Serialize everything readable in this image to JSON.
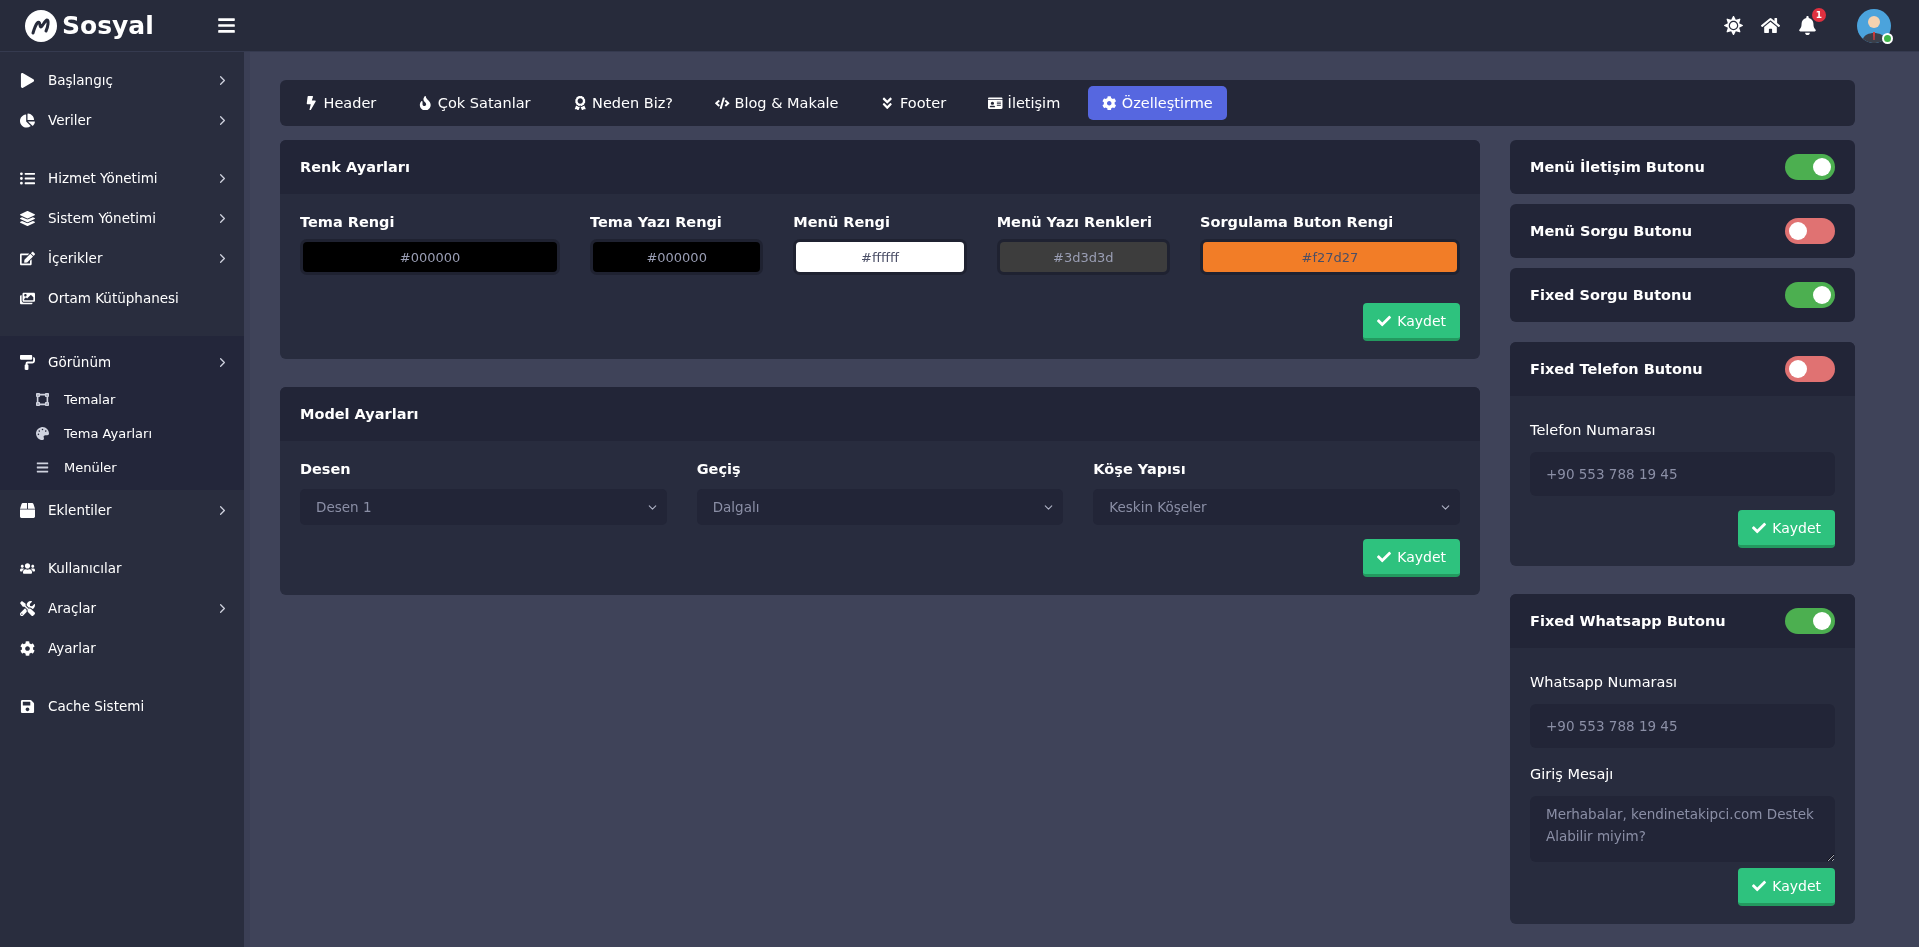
{
  "brand": {
    "name": "Sosyal"
  },
  "topbar": {
    "notifications": "1",
    "user_online": true
  },
  "sidebar": {
    "sections": [
      [
        {
          "label": "Başlangıç",
          "arrow": true,
          "expanded": false
        },
        {
          "label": "Veriler",
          "arrow": true,
          "expanded": false
        }
      ],
      [
        {
          "label": "Hizmet Yönetimi",
          "arrow": true,
          "expanded": false
        },
        {
          "label": "Sistem Yönetimi",
          "arrow": true,
          "expanded": false
        },
        {
          "label": "İçerikler",
          "arrow": true,
          "expanded": false
        },
        {
          "label": "Ortam Kütüphanesi",
          "arrow": false,
          "expanded": false
        }
      ],
      [
        {
          "label": "Görünüm",
          "arrow": true,
          "expanded": true,
          "children": [
            {
              "label": "Temalar"
            },
            {
              "label": "Tema Ayarları"
            },
            {
              "label": "Menüler"
            }
          ]
        },
        {
          "label": "Eklentiler",
          "arrow": true,
          "expanded": false
        }
      ],
      [
        {
          "label": "Kullanıcılar",
          "arrow": false,
          "expanded": false
        },
        {
          "label": "Araçlar",
          "arrow": true,
          "expanded": false
        },
        {
          "label": "Ayarlar",
          "arrow": false,
          "expanded": false
        }
      ],
      [
        {
          "label": "Cache Sistemi",
          "arrow": false,
          "expanded": false
        }
      ]
    ]
  },
  "tabs": [
    {
      "label": "Header",
      "selected": false
    },
    {
      "label": "Çok Satanlar",
      "selected": false
    },
    {
      "label": "Neden Biz?",
      "selected": false
    },
    {
      "label": "Blog & Makale",
      "selected": false
    },
    {
      "label": "Footer",
      "selected": false
    },
    {
      "label": "İletişim",
      "selected": false
    },
    {
      "label": "Özelleştirme",
      "selected": true
    }
  ],
  "renk": {
    "title": "Renk Ayarları",
    "button": "Kaydet",
    "fields": [
      {
        "label": "Tema Rengi",
        "value": "#000000",
        "color": "#000000"
      },
      {
        "label": "Tema Yazı Rengi",
        "value": "#000000",
        "color": "#000000"
      },
      {
        "label": "Menü Rengi",
        "value": "#ffffff",
        "color": "#ffffff"
      },
      {
        "label": "Menü Yazı Renkleri",
        "value": "#3d3d3d",
        "color": "#3d3d3d"
      },
      {
        "label": "Sorgulama Buton Rengi",
        "value": "#f27d27",
        "color": "#f27d27"
      }
    ]
  },
  "model": {
    "title": "Model Ayarları",
    "button": "Kaydet",
    "selects": [
      {
        "label": "Desen",
        "value": "Desen 1"
      },
      {
        "label": "Geçiş",
        "value": "Dalgalı"
      },
      {
        "label": "Köşe Yapısı",
        "value": "Keskin Köşeler"
      }
    ]
  },
  "toggles": [
    {
      "title": "Menü İletişim Butonu",
      "on": true
    },
    {
      "title": "Menü Sorgu Butonu",
      "on": false
    },
    {
      "title": "Fixed Sorgu Butonu",
      "on": true
    },
    {
      "title": "Fixed Telefon Butonu",
      "on": false,
      "button": "Kaydet",
      "fields": [
        {
          "kind": "input",
          "label": "Telefon Numarası",
          "placeholder": "+90 553 788 19 45"
        }
      ]
    },
    {
      "title": "Fixed Whatsapp Butonu",
      "on": true,
      "button": "Kaydet",
      "fields": [
        {
          "kind": "input",
          "label": "Whatsapp Numarası",
          "placeholder": "+90 553 788 19 45"
        },
        {
          "kind": "textarea",
          "label": "Giriş Mesajı",
          "placeholder": "Merhabalar, kendinetakipci.com Destek Alabilir miyim?"
        }
      ]
    }
  ]
}
